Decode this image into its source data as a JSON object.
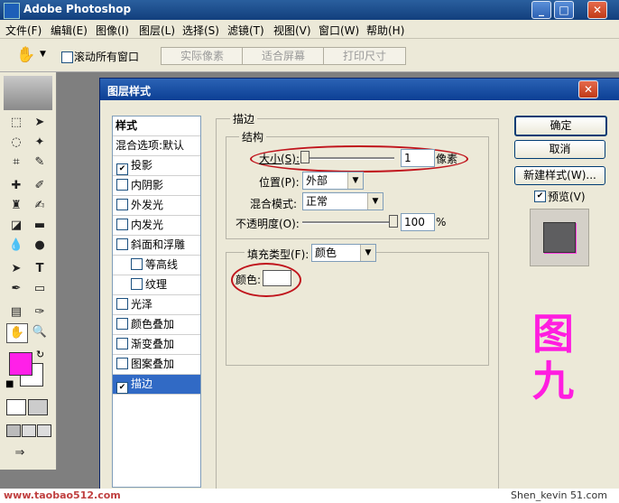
{
  "app": {
    "title": "Adobe Photoshop",
    "win_buttons": {
      "minimize": "_",
      "maximize": "□",
      "close": "✕"
    }
  },
  "menu": [
    "文件(F)",
    "编辑(E)",
    "图像(I)",
    "图层(L)",
    "选择(S)",
    "滤镜(T)",
    "视图(V)",
    "窗口(W)",
    "帮助(H)"
  ],
  "options": {
    "scroll_all_label": "滚动所有窗口",
    "actual_pixels": "实际像素",
    "fit_screen": "适合屏幕",
    "print_size": "打印尺寸"
  },
  "dialog": {
    "title": "图层样式",
    "close": "✕",
    "styles_header": "样式",
    "blend_default": "混合选项:默认",
    "style_items": [
      {
        "label": "投影",
        "checked": true
      },
      {
        "label": "内阴影",
        "checked": false
      },
      {
        "label": "外发光",
        "checked": false
      },
      {
        "label": "内发光",
        "checked": false
      },
      {
        "label": "斜面和浮雕",
        "checked": false
      },
      {
        "label": "等高线",
        "checked": false
      },
      {
        "label": "纹理",
        "checked": false
      },
      {
        "label": "光泽",
        "checked": false
      },
      {
        "label": "颜色叠加",
        "checked": false
      },
      {
        "label": "渐变叠加",
        "checked": false
      },
      {
        "label": "图案叠加",
        "checked": false
      },
      {
        "label": "描边",
        "checked": true,
        "selected": true
      }
    ],
    "stroke": {
      "section_title": "描边",
      "structure_title": "结构",
      "size_label": "大小(S):",
      "size_value": "1",
      "size_unit": "像素",
      "position_label": "位置(P):",
      "position_value": "外部",
      "blend_label": "混合模式:",
      "blend_value": "正常",
      "opacity_label": "不透明度(O):",
      "opacity_value": "100",
      "opacity_unit": "%",
      "fill_type_label": "填充类型(F):",
      "fill_type_value": "颜色",
      "color_label": "颜色:"
    },
    "buttons": {
      "ok": "确定",
      "cancel": "取消",
      "new_style": "新建样式(W)...",
      "preview_label": "预览(V)"
    }
  },
  "annotation": {
    "figure_label": "图九"
  },
  "footer": {
    "left_watermark": "www.taobao512.com",
    "right_watermark": "Shen_kevin 51.com"
  },
  "colors": {
    "foreground": "#ff20e8",
    "background": "#ffffff",
    "annotation": "#ff1de0"
  }
}
